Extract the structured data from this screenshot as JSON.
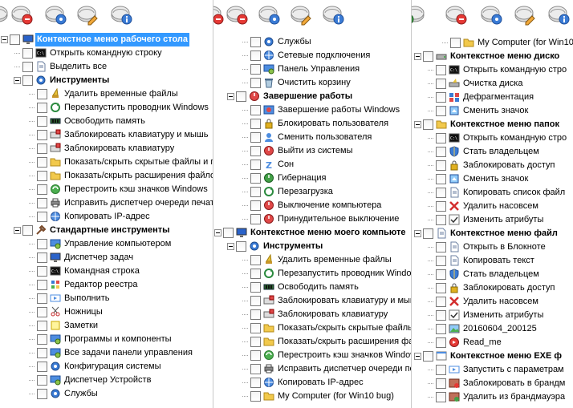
{
  "toolbar_icons": [
    "add-icon",
    "remove-icon",
    "settings-icon",
    "edit-icon",
    "info-icon"
  ],
  "panel1": {
    "rows": [
      {
        "label": "Контекстное меню рабочего стола",
        "icon": "desktop-icon",
        "indent": 0,
        "bold": true,
        "exp": true,
        "selected": true
      },
      {
        "label": "Открыть командную строку",
        "icon": "console-icon",
        "indent": 1
      },
      {
        "label": "Выделить все",
        "icon": "document-icon",
        "indent": 1
      },
      {
        "label": "Инструменты",
        "icon": "gear-icon",
        "indent": 1,
        "bold": true,
        "exp": true
      },
      {
        "label": "Удалить временные файлы",
        "icon": "broom-icon",
        "indent": 2
      },
      {
        "label": "Перезапустить проводник Windows",
        "icon": "refresh-icon",
        "indent": 2
      },
      {
        "label": "Освободить память",
        "icon": "memory-icon",
        "indent": 2
      },
      {
        "label": "Заблокировать клавиатуру и мышь",
        "icon": "keyboard-lock-icon",
        "indent": 2
      },
      {
        "label": "Заблокировать клавиатуру",
        "icon": "keyboard-lock-icon",
        "indent": 2
      },
      {
        "label": "Показать/скрыть скрытые файлы и п",
        "icon": "folder-icon",
        "indent": 2
      },
      {
        "label": "Показать/скрыть расширения файлов",
        "icon": "folder-icon",
        "indent": 2
      },
      {
        "label": "Перестроить кэш значков Windows",
        "icon": "recycle-icon",
        "indent": 2
      },
      {
        "label": "Исправить диспетчер очереди печати",
        "icon": "printer-icon",
        "indent": 2
      },
      {
        "label": "Копировать IP-адрес",
        "icon": "network-icon",
        "indent": 2
      },
      {
        "label": "Стандартные инструменты",
        "icon": "tools-icon",
        "indent": 1,
        "bold": true,
        "exp": true
      },
      {
        "label": "Управление компьютером",
        "icon": "computer-manage-icon",
        "indent": 2
      },
      {
        "label": "Диспетчер задач",
        "icon": "monitor-icon",
        "indent": 2
      },
      {
        "label": "Командная строка",
        "icon": "console-icon",
        "indent": 2
      },
      {
        "label": "Редактор реестра",
        "icon": "registry-icon",
        "indent": 2
      },
      {
        "label": "Выполнить",
        "icon": "run-icon",
        "indent": 2
      },
      {
        "label": "Ножницы",
        "icon": "scissors-icon",
        "indent": 2
      },
      {
        "label": "Заметки",
        "icon": "note-icon",
        "indent": 2
      },
      {
        "label": "Программы и компоненты",
        "icon": "programs-icon",
        "indent": 2
      },
      {
        "label": "Все задачи панели управления",
        "icon": "control-panel-icon",
        "indent": 2
      },
      {
        "label": "Конфигурация системы",
        "icon": "config-icon",
        "indent": 2
      },
      {
        "label": "Диспетчер Устройств",
        "icon": "device-icon",
        "indent": 2
      },
      {
        "label": "Службы",
        "icon": "services-icon",
        "indent": 2
      }
    ]
  },
  "panel2": {
    "rows": [
      {
        "label": "Службы",
        "icon": "services-icon",
        "indent": 2
      },
      {
        "label": "Сетевые подключения",
        "icon": "network-icon",
        "indent": 2
      },
      {
        "label": "Панель Управления",
        "icon": "control-panel-icon",
        "indent": 2
      },
      {
        "label": "Очистить корзину",
        "icon": "recycle-bin-icon",
        "indent": 2
      },
      {
        "label": "Завершение работы",
        "icon": "power-icon",
        "indent": 1,
        "bold": true,
        "exp": true
      },
      {
        "label": "Завершение работы Windows",
        "icon": "shutdown-dialog-icon",
        "indent": 2
      },
      {
        "label": "Блокировать пользователя",
        "icon": "lock-icon",
        "indent": 2
      },
      {
        "label": "Сменить пользователя",
        "icon": "user-switch-icon",
        "indent": 2
      },
      {
        "label": "Выйти из системы",
        "icon": "logoff-icon",
        "indent": 2
      },
      {
        "label": "Сон",
        "icon": "sleep-icon",
        "indent": 2
      },
      {
        "label": "Гибернация",
        "icon": "hibernate-icon",
        "indent": 2
      },
      {
        "label": "Перезагрузка",
        "icon": "restart-icon",
        "indent": 2
      },
      {
        "label": "Выключение компьютера",
        "icon": "power-icon",
        "indent": 2
      },
      {
        "label": "Принудительное выключение",
        "icon": "power-icon",
        "indent": 2
      },
      {
        "label": "Контекстное меню моего компьюте",
        "icon": "computer-icon",
        "indent": 0,
        "bold": true,
        "exp": true
      },
      {
        "label": "Инструменты",
        "icon": "gear-icon",
        "indent": 1,
        "bold": true,
        "exp": true
      },
      {
        "label": "Удалить временные файлы",
        "icon": "broom-icon",
        "indent": 2
      },
      {
        "label": "Перезапустить проводник Window",
        "icon": "refresh-icon",
        "indent": 2
      },
      {
        "label": "Освободить память",
        "icon": "memory-icon",
        "indent": 2
      },
      {
        "label": "Заблокировать клавиатуру и мыш",
        "icon": "keyboard-lock-icon",
        "indent": 2
      },
      {
        "label": "Заблокировать клавиатуру",
        "icon": "keyboard-lock-icon",
        "indent": 2
      },
      {
        "label": "Показать/скрыть скрытые файлы",
        "icon": "folder-icon",
        "indent": 2
      },
      {
        "label": "Показать/скрыть расширения фай",
        "icon": "folder-icon",
        "indent": 2
      },
      {
        "label": "Перестроить кэш значков Windows",
        "icon": "recycle-icon",
        "indent": 2
      },
      {
        "label": "Исправить диспетчер очереди пе",
        "icon": "printer-icon",
        "indent": 2
      },
      {
        "label": "Копировать IP-адрес",
        "icon": "network-icon",
        "indent": 2
      },
      {
        "label": "My Computer (for Win10 bug)",
        "icon": "folder-icon",
        "indent": 2
      }
    ]
  },
  "panel3": {
    "rows": [
      {
        "label": "My Computer (for Win10",
        "icon": "folder-icon",
        "indent": 2
      },
      {
        "label": "Контекстное меню диско",
        "icon": "drive-icon",
        "indent": 0,
        "bold": true,
        "exp": true
      },
      {
        "label": "Открыть командную стро",
        "icon": "console-icon",
        "indent": 1
      },
      {
        "label": "Очистка диска",
        "icon": "disk-cleanup-icon",
        "indent": 1
      },
      {
        "label": "Дефрагментация",
        "icon": "defrag-icon",
        "indent": 1
      },
      {
        "label": "Сменить значок",
        "icon": "change-icon-icon",
        "indent": 1
      },
      {
        "label": "Контекстное меню папок",
        "icon": "folder-icon",
        "indent": 0,
        "bold": true,
        "exp": true
      },
      {
        "label": "Открыть командную стро",
        "icon": "console-icon",
        "indent": 1
      },
      {
        "label": "Стать владельцем",
        "icon": "shield-icon",
        "indent": 1
      },
      {
        "label": "Заблокировать доступ",
        "icon": "lock-icon",
        "indent": 1
      },
      {
        "label": "Сменить значок",
        "icon": "change-icon-icon",
        "indent": 1
      },
      {
        "label": "Копировать список файл",
        "icon": "copy-list-icon",
        "indent": 1
      },
      {
        "label": "Удалить насовсем",
        "icon": "delete-x-icon",
        "indent": 1
      },
      {
        "label": "Изменить атрибуты",
        "icon": "check-icon",
        "indent": 1
      },
      {
        "label": "Контекстное меню файл",
        "icon": "file-icon",
        "indent": 0,
        "bold": true,
        "exp": true
      },
      {
        "label": "Открыть в Блокноте",
        "icon": "notepad-icon",
        "indent": 1
      },
      {
        "label": "Копировать текст",
        "icon": "copy-text-icon",
        "indent": 1
      },
      {
        "label": "Стать владельцем",
        "icon": "shield-icon",
        "indent": 1
      },
      {
        "label": "Заблокировать доступ",
        "icon": "lock-icon",
        "indent": 1
      },
      {
        "label": "Удалить насовсем",
        "icon": "delete-x-icon",
        "indent": 1
      },
      {
        "label": "Изменить атрибуты",
        "icon": "check-icon",
        "indent": 1
      },
      {
        "label": "20160604_200125",
        "icon": "image-icon",
        "indent": 1
      },
      {
        "label": "Read_me",
        "icon": "read-me-icon",
        "indent": 1
      },
      {
        "label": "Контекстное меню EXE ф",
        "icon": "exe-icon",
        "indent": 0,
        "bold": true,
        "exp": true
      },
      {
        "label": "Запустить с параметрам",
        "icon": "run-params-icon",
        "indent": 1
      },
      {
        "label": "Заблокировать в брандм",
        "icon": "firewall-block-icon",
        "indent": 1
      },
      {
        "label": "Удалить из брандмауэра",
        "icon": "firewall-allow-icon",
        "indent": 1
      }
    ]
  }
}
